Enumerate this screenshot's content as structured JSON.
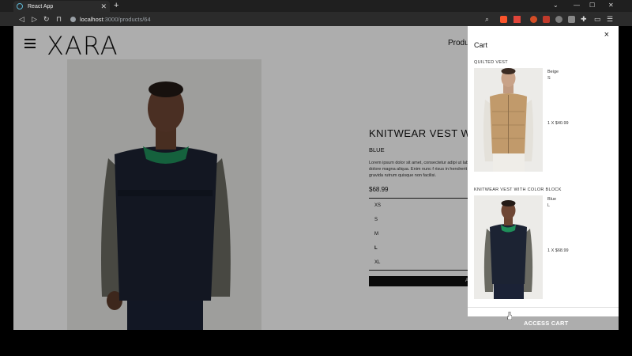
{
  "browser": {
    "tab_title": "React App",
    "tab_close": "✕",
    "new_tab": "+",
    "url_host": "localhost",
    "url_path": ":3000/products/64",
    "window_controls": {
      "minimize": "—",
      "maximize": "☐",
      "close": "✕"
    }
  },
  "site": {
    "logo": "XARA",
    "nav_products": "Produ"
  },
  "product": {
    "title": "KNITWEAR VEST WIT",
    "color": "BLUE",
    "description": "Lorem ipsum dolor sit amet, consectetur adipi ut labore et dolore magna aliqua. Enim nunc f risus in hendrerit gravida rutrum quisque non facilisi.",
    "price": "$68.99",
    "sizes": [
      "XS",
      "S",
      "M",
      "L",
      "XL"
    ],
    "selected_size": "L",
    "add_button": "Add t"
  },
  "cart": {
    "title": "Cart",
    "close": "×",
    "items": [
      {
        "name": "QUILTED VEST",
        "color": "Beige",
        "size": "S",
        "qty_price": "1 X $40.99"
      },
      {
        "name": "KNITWEAR VEST WITH COLOR BLOCK",
        "color": "Blue",
        "size": "L",
        "qty_price": "1 X $68.99"
      }
    ]
  },
  "footer": {
    "access_cart": "ACCESS CART"
  },
  "colors": {
    "accent_green": "#1f8f5a",
    "vest_navy": "#1c2333",
    "vest_beige": "#c19a6b"
  }
}
